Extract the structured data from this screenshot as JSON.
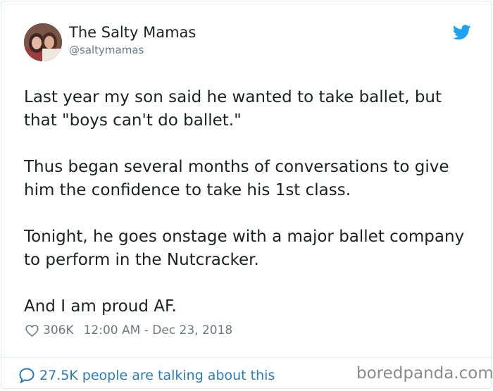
{
  "user": {
    "display_name": "The Salty Mamas",
    "handle": "@saltymamas"
  },
  "tweet": {
    "paragraphs": [
      "Last year my son said he wanted to take ballet, but that \"boys can't do ballet.\"",
      "Thus began several months of conversations to give him the confidence to take his 1st class.",
      "Tonight, he goes onstage with a major ballet company to perform in the Nutcracker.",
      "And I am proud AF."
    ]
  },
  "meta": {
    "likes": "306K",
    "timestamp": "12:00 AM - Dec 23, 2018"
  },
  "footer": {
    "talking_text": "27.5K people are talking about this"
  },
  "watermark": "boredpanda.com",
  "colors": {
    "twitter_blue": "#1da1f2",
    "link_blue": "#2b7bb9",
    "muted_gray": "#697882"
  },
  "icons": {
    "bird": "twitter-bird-icon",
    "heart": "heart-icon",
    "bubble": "speech-bubble-icon"
  }
}
